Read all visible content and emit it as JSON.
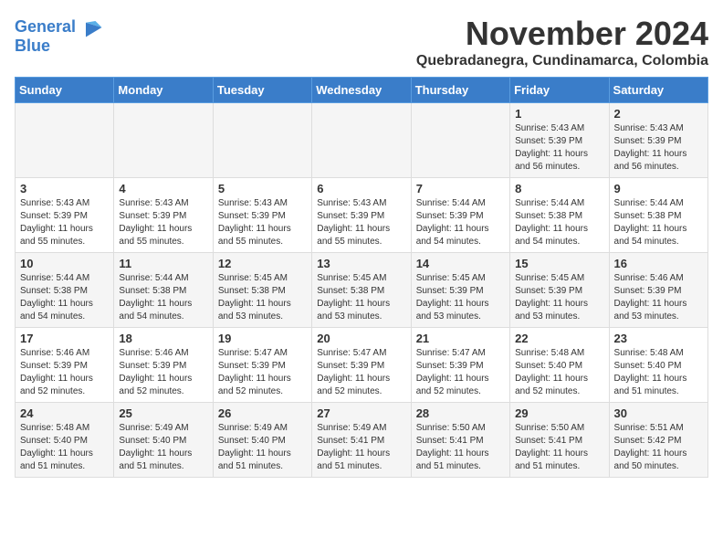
{
  "header": {
    "logo_line1": "General",
    "logo_line2": "Blue",
    "month": "November 2024",
    "location": "Quebradanegra, Cundinamarca, Colombia"
  },
  "weekdays": [
    "Sunday",
    "Monday",
    "Tuesday",
    "Wednesday",
    "Thursday",
    "Friday",
    "Saturday"
  ],
  "weeks": [
    [
      {
        "day": "",
        "info": ""
      },
      {
        "day": "",
        "info": ""
      },
      {
        "day": "",
        "info": ""
      },
      {
        "day": "",
        "info": ""
      },
      {
        "day": "",
        "info": ""
      },
      {
        "day": "1",
        "info": "Sunrise: 5:43 AM\nSunset: 5:39 PM\nDaylight: 11 hours and 56 minutes."
      },
      {
        "day": "2",
        "info": "Sunrise: 5:43 AM\nSunset: 5:39 PM\nDaylight: 11 hours and 56 minutes."
      }
    ],
    [
      {
        "day": "3",
        "info": "Sunrise: 5:43 AM\nSunset: 5:39 PM\nDaylight: 11 hours and 55 minutes."
      },
      {
        "day": "4",
        "info": "Sunrise: 5:43 AM\nSunset: 5:39 PM\nDaylight: 11 hours and 55 minutes."
      },
      {
        "day": "5",
        "info": "Sunrise: 5:43 AM\nSunset: 5:39 PM\nDaylight: 11 hours and 55 minutes."
      },
      {
        "day": "6",
        "info": "Sunrise: 5:43 AM\nSunset: 5:39 PM\nDaylight: 11 hours and 55 minutes."
      },
      {
        "day": "7",
        "info": "Sunrise: 5:44 AM\nSunset: 5:39 PM\nDaylight: 11 hours and 54 minutes."
      },
      {
        "day": "8",
        "info": "Sunrise: 5:44 AM\nSunset: 5:38 PM\nDaylight: 11 hours and 54 minutes."
      },
      {
        "day": "9",
        "info": "Sunrise: 5:44 AM\nSunset: 5:38 PM\nDaylight: 11 hours and 54 minutes."
      }
    ],
    [
      {
        "day": "10",
        "info": "Sunrise: 5:44 AM\nSunset: 5:38 PM\nDaylight: 11 hours and 54 minutes."
      },
      {
        "day": "11",
        "info": "Sunrise: 5:44 AM\nSunset: 5:38 PM\nDaylight: 11 hours and 54 minutes."
      },
      {
        "day": "12",
        "info": "Sunrise: 5:45 AM\nSunset: 5:38 PM\nDaylight: 11 hours and 53 minutes."
      },
      {
        "day": "13",
        "info": "Sunrise: 5:45 AM\nSunset: 5:38 PM\nDaylight: 11 hours and 53 minutes."
      },
      {
        "day": "14",
        "info": "Sunrise: 5:45 AM\nSunset: 5:39 PM\nDaylight: 11 hours and 53 minutes."
      },
      {
        "day": "15",
        "info": "Sunrise: 5:45 AM\nSunset: 5:39 PM\nDaylight: 11 hours and 53 minutes."
      },
      {
        "day": "16",
        "info": "Sunrise: 5:46 AM\nSunset: 5:39 PM\nDaylight: 11 hours and 53 minutes."
      }
    ],
    [
      {
        "day": "17",
        "info": "Sunrise: 5:46 AM\nSunset: 5:39 PM\nDaylight: 11 hours and 52 minutes."
      },
      {
        "day": "18",
        "info": "Sunrise: 5:46 AM\nSunset: 5:39 PM\nDaylight: 11 hours and 52 minutes."
      },
      {
        "day": "19",
        "info": "Sunrise: 5:47 AM\nSunset: 5:39 PM\nDaylight: 11 hours and 52 minutes."
      },
      {
        "day": "20",
        "info": "Sunrise: 5:47 AM\nSunset: 5:39 PM\nDaylight: 11 hours and 52 minutes."
      },
      {
        "day": "21",
        "info": "Sunrise: 5:47 AM\nSunset: 5:39 PM\nDaylight: 11 hours and 52 minutes."
      },
      {
        "day": "22",
        "info": "Sunrise: 5:48 AM\nSunset: 5:40 PM\nDaylight: 11 hours and 52 minutes."
      },
      {
        "day": "23",
        "info": "Sunrise: 5:48 AM\nSunset: 5:40 PM\nDaylight: 11 hours and 51 minutes."
      }
    ],
    [
      {
        "day": "24",
        "info": "Sunrise: 5:48 AM\nSunset: 5:40 PM\nDaylight: 11 hours and 51 minutes."
      },
      {
        "day": "25",
        "info": "Sunrise: 5:49 AM\nSunset: 5:40 PM\nDaylight: 11 hours and 51 minutes."
      },
      {
        "day": "26",
        "info": "Sunrise: 5:49 AM\nSunset: 5:40 PM\nDaylight: 11 hours and 51 minutes."
      },
      {
        "day": "27",
        "info": "Sunrise: 5:49 AM\nSunset: 5:41 PM\nDaylight: 11 hours and 51 minutes."
      },
      {
        "day": "28",
        "info": "Sunrise: 5:50 AM\nSunset: 5:41 PM\nDaylight: 11 hours and 51 minutes."
      },
      {
        "day": "29",
        "info": "Sunrise: 5:50 AM\nSunset: 5:41 PM\nDaylight: 11 hours and 51 minutes."
      },
      {
        "day": "30",
        "info": "Sunrise: 5:51 AM\nSunset: 5:42 PM\nDaylight: 11 hours and 50 minutes."
      }
    ]
  ]
}
